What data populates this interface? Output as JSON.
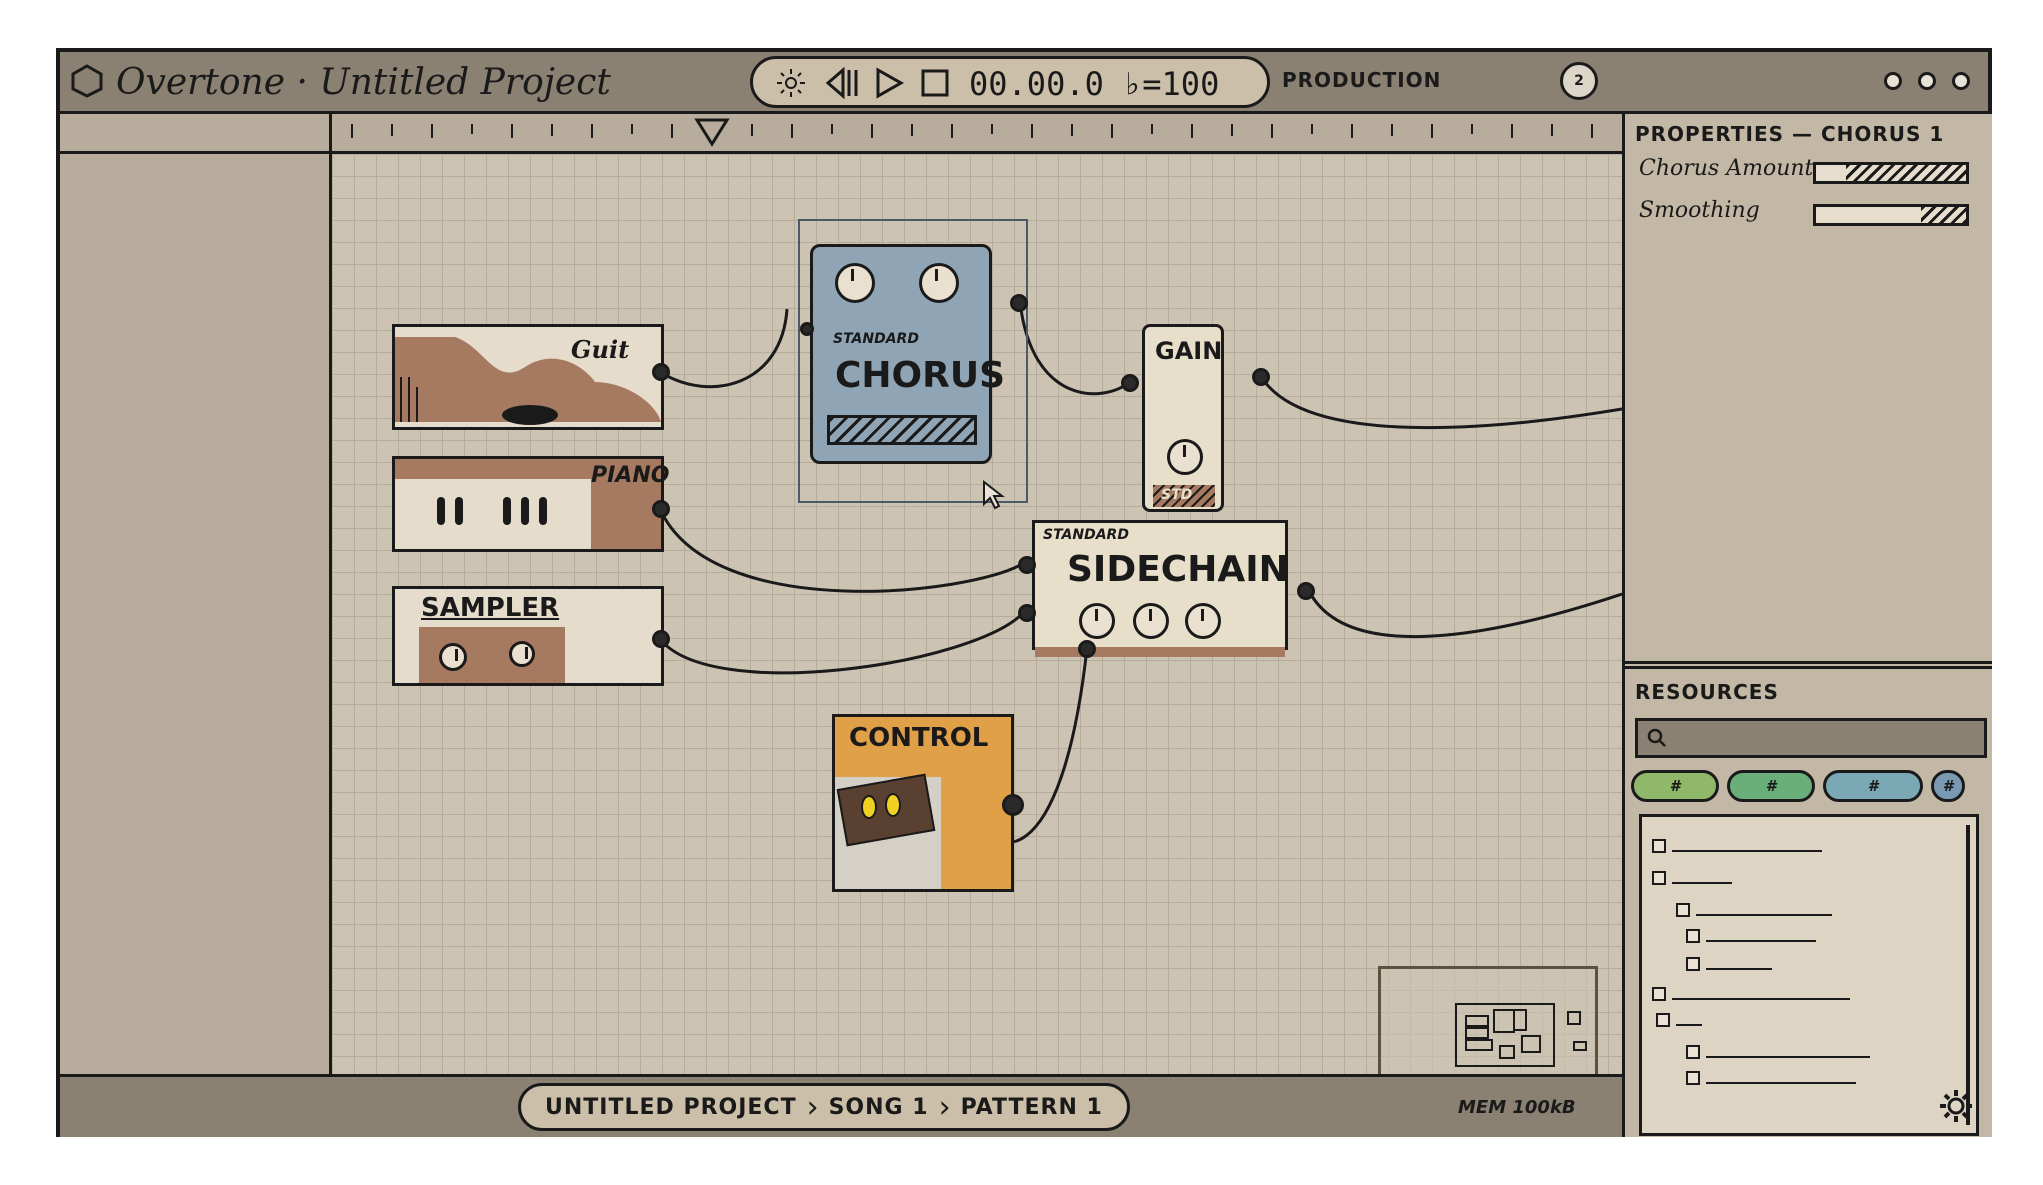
{
  "window": {
    "app_name": "Overtone",
    "separator": "·",
    "project_title": "Untitled Project"
  },
  "transport": {
    "timecode": "00.00.0",
    "tempo": "♭=100",
    "icons": [
      "metronome-icon",
      "rewind-icon",
      "play-icon",
      "stop-icon"
    ]
  },
  "toolbar": {
    "mode": "PRODUCTION",
    "user_badge": "2"
  },
  "canvas": {
    "nodes": [
      {
        "id": "guitar",
        "label": "Guit",
        "color": "#a67a60"
      },
      {
        "id": "piano",
        "label": "PIANO",
        "color": "#a67a60"
      },
      {
        "id": "sampler",
        "label": "SAMPLER",
        "color": "#a67a60"
      },
      {
        "id": "chorus",
        "label": "CHORUS",
        "sub": "STANDARD",
        "color": "#8fa5b5"
      },
      {
        "id": "gain",
        "label": "GAIN",
        "sub": "STD",
        "color": "#e8dfcb"
      },
      {
        "id": "sidechain",
        "label": "SIDECHAIN",
        "sub": "STANDARD",
        "color": "#e8dfcb"
      },
      {
        "id": "control",
        "label": "CONTROL",
        "color": "#e0a048"
      }
    ]
  },
  "properties": {
    "title": "PROPERTIES — CHORUS 1",
    "rows": [
      {
        "label": "Chorus Amount",
        "fill": 0.8
      },
      {
        "label": "Smoothing",
        "fill": 0.3
      }
    ]
  },
  "resources": {
    "title": "RESOURCES",
    "search_placeholder": "",
    "tags": [
      {
        "label": "#",
        "color": "#8fb86a"
      },
      {
        "label": "#",
        "color": "#6aae7a"
      },
      {
        "label": "#",
        "color": "#7aa8b4"
      },
      {
        "label": "#",
        "color": "#7a9ab4"
      }
    ]
  },
  "statusbar": {
    "breadcrumbs": [
      "UNTITLED PROJECT",
      "SONG 1",
      "PATTERN 1"
    ],
    "memory": "MEM 100kB"
  }
}
